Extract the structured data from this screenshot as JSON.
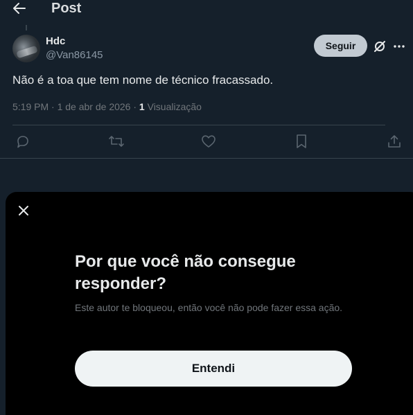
{
  "header": {
    "title": "Post",
    "back_icon": "arrow-left-icon"
  },
  "post": {
    "author": {
      "name": "Hdc",
      "handle": "@Van86145"
    },
    "follow_label": "Seguir",
    "text": "Não é a toa que tem nome de técnico fracassado.",
    "time": "5:19 PM",
    "date": "1 de abr de 2026",
    "separator": "·",
    "views_count": "1",
    "views_label": "Visualização"
  },
  "actions": [
    "reply-icon",
    "repost-icon",
    "like-icon",
    "bookmark-icon",
    "share-icon"
  ],
  "dialog": {
    "title": "Por que você não consegue responder?",
    "description": "Este autor te bloqueou, então você não pode fazer essa ação.",
    "button_label": "Entendi"
  },
  "colors": {
    "background": "#15202b",
    "sheet": "#000000",
    "follow_button": "#c2cad2",
    "primary_button": "#eff3f4",
    "muted_text": "#71767b",
    "divider": "#38444d"
  }
}
